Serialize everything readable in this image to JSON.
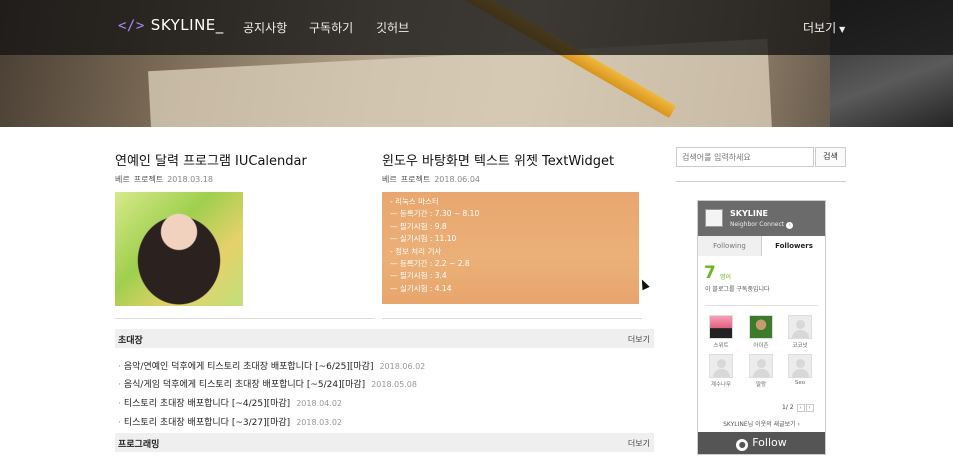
{
  "header": {
    "logo_code": "</>",
    "logo_text": "SKYLINE_",
    "nav": [
      "공지사항",
      "구독하기",
      "깃허브"
    ],
    "more": "더보기"
  },
  "posts": [
    {
      "title": "연예인 달력 프로그램 IUCalendar",
      "category": "베르",
      "sub_category": "프로젝트",
      "date": "2018.03.18"
    },
    {
      "title": "윈도우 바탕화면 텍스트 위젯 TextWidget",
      "category": "베르",
      "sub_category": "프로젝트",
      "date": "2018.06.04",
      "thumb_lines": [
        "- 리눅스 마스터",
        "— 등록기간 : 7.30 ~ 8.10",
        "— 필기시험 : 9.8",
        "— 실기시험 : 11.10",
        "- 정보 처리 기사",
        "— 등록기간 : 2.2 ~ 2.8",
        "— 필기시험 : 3.4",
        "— 실기시험 : 4.14"
      ]
    }
  ],
  "sections": [
    {
      "title": "초대장",
      "more": "더보기",
      "items": [
        {
          "text": "음악/연예인 덕후에게 티스토리 초대장 배포합니다 [~6/25][마감]",
          "date": "2018.06.02"
        },
        {
          "text": "음식/게임 덕후에게 티스토리 초대장 배포합니다 [~5/24][마감]",
          "date": "2018.05.08"
        },
        {
          "text": "티스토리 초대장 배포합니다 [~4/25][마감]",
          "date": "2018.04.02"
        },
        {
          "text": "티스토리 초대장 배포합니다 [~3/27][마감]",
          "date": "2018.03.02"
        }
      ]
    },
    {
      "title": "프로그래밍",
      "more": "더보기",
      "items": []
    }
  ],
  "sidebar": {
    "search_placeholder": "검색어를 입력하세요",
    "search_button": "검색",
    "widget": {
      "name": "SKYLINE",
      "subtitle": "Neighbor Connect",
      "tabs": [
        "Following",
        "Followers"
      ],
      "count": "7",
      "unit": "명이",
      "desc": "이 블로그를 구독중입니다",
      "followers": [
        "스위트",
        "아이존",
        "코코넛",
        "계수나무",
        "말랑",
        "Seo"
      ],
      "page": "1/ 2",
      "footer": "SKYLINE님 이웃의 새글보기",
      "follow": "Follow"
    }
  }
}
